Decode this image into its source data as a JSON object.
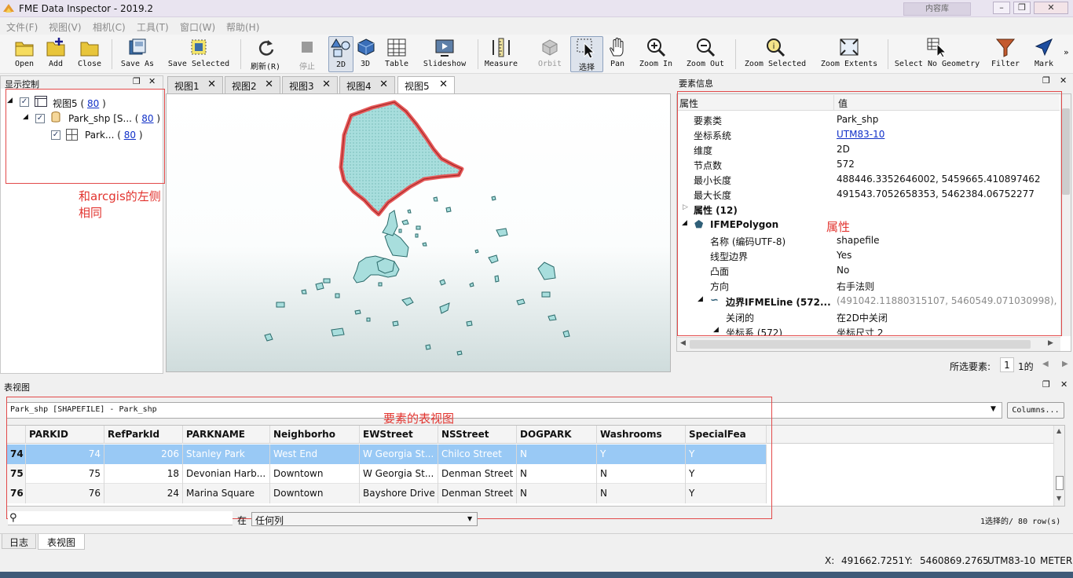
{
  "window": {
    "title": "FME Data Inspector - 2019.2",
    "ghost_tab": "内容库"
  },
  "menu": [
    "文件(F)",
    "视图(V)",
    "相机(C)",
    "工具(T)",
    "窗口(W)",
    "帮助(H)"
  ],
  "toolbar": {
    "open": "Open",
    "add": "Add",
    "close": "Close",
    "save_as": "Save As",
    "save_selected": "Save Selected",
    "refresh": "刷新(R)",
    "stop": "停止",
    "view2d": "2D",
    "view3d": "3D",
    "table": "Table",
    "slideshow": "Slideshow",
    "measure": "Measure",
    "orbit": "Orbit",
    "select": "选择",
    "pan": "Pan",
    "zoom_in": "Zoom In",
    "zoom_out": "Zoom Out",
    "zoom_selected": "Zoom Selected",
    "zoom_extents": "Zoom Extents",
    "select_no_geometry": "Select No Geometry",
    "filter": "Filter",
    "mark": "Mark"
  },
  "display_panel": {
    "title": "显示控制",
    "tree": [
      {
        "label": "视图5 (",
        "count": "80",
        "tail": ")"
      },
      {
        "label": "Park_shp [S... (",
        "count": "80",
        "tail": ")"
      },
      {
        "label": "Park... (",
        "count": "80",
        "tail": ")"
      }
    ],
    "note": "和arcgis的左侧相同"
  },
  "view_tabs": [
    "视图1",
    "视图2",
    "视图3",
    "视图4",
    "视图5"
  ],
  "feature_info": {
    "title": "要素信息",
    "col_attr": "属性",
    "col_val": "值",
    "rows": [
      {
        "k": "要素类",
        "v": "Park_shp"
      },
      {
        "k": "坐标系统",
        "v": "UTM83-10"
      },
      {
        "k": "维度",
        "v": "2D"
      },
      {
        "k": "节点数",
        "v": "572"
      },
      {
        "k": "最小长度",
        "v": "488446.3352646002, 5459665.410897462"
      },
      {
        "k": "最大长度",
        "v": "491543.7052658353, 5462384.06752277"
      },
      {
        "k": "属性 (12)",
        "v": ""
      },
      {
        "k": "IFMEPolygon",
        "v": ""
      },
      {
        "k": "名称 (编码UTF-8)",
        "v": "shapefile"
      },
      {
        "k": "线型边界",
        "v": "Yes"
      },
      {
        "k": "凸面",
        "v": "No"
      },
      {
        "k": "方向",
        "v": "右手法则"
      },
      {
        "k": "边界IFMELine (572...",
        "v": "(491042.11880315107, 5460549.071030998), ..."
      },
      {
        "k": "关闭的",
        "v": "在2D中关闭"
      },
      {
        "k": "坐标系 (572)",
        "v": "坐标尺寸 2"
      }
    ],
    "note": "属性",
    "selected_label": "所选要素:",
    "selected_value": "1",
    "selected_of": "1的"
  },
  "table_view": {
    "title": "表视图",
    "dataset": "Park_shp [SHAPEFILE] - Park_shp",
    "columns_button": "Columns...",
    "note": "要素的表视图",
    "headers": [
      "PARKID",
      "RefParkId",
      "PARKNAME",
      "Neighborho",
      "EWStreet",
      "NSStreet",
      "DOGPARK",
      "Washrooms",
      "SpecialFea"
    ],
    "rows": [
      {
        "idx": "74",
        "cells": [
          "74",
          "206",
          "Stanley Park",
          "West End",
          "W Georgia St...",
          "Chilco Street",
          "N",
          "Y",
          "Y"
        ]
      },
      {
        "idx": "75",
        "cells": [
          "75",
          "18",
          "Devonian Harb...",
          "Downtown",
          "W Georgia St...",
          "Denman Street",
          "N",
          "N",
          "Y"
        ]
      },
      {
        "idx": "76",
        "cells": [
          "76",
          "24",
          "Marina Square",
          "Downtown",
          "Bayshore Drive",
          "Denman Street",
          "N",
          "N",
          "Y"
        ]
      }
    ],
    "search_in": "在",
    "search_scope": "任何列",
    "status": "1选择的/ 80 row(s)"
  },
  "bottom_tabs": [
    "日志",
    "表视图"
  ],
  "status_bar": {
    "x_label": "X:",
    "x": "491662.7251",
    "y_label": "Y:",
    "y": "5460869.2765",
    "crs": "UTM83-10",
    "unit": "METER"
  },
  "colors": {
    "accent_red": "#e24a4a",
    "selection_blue": "#99c9f5",
    "park_fill": "#a8dedd",
    "park_outline": "#2a6a6a"
  }
}
